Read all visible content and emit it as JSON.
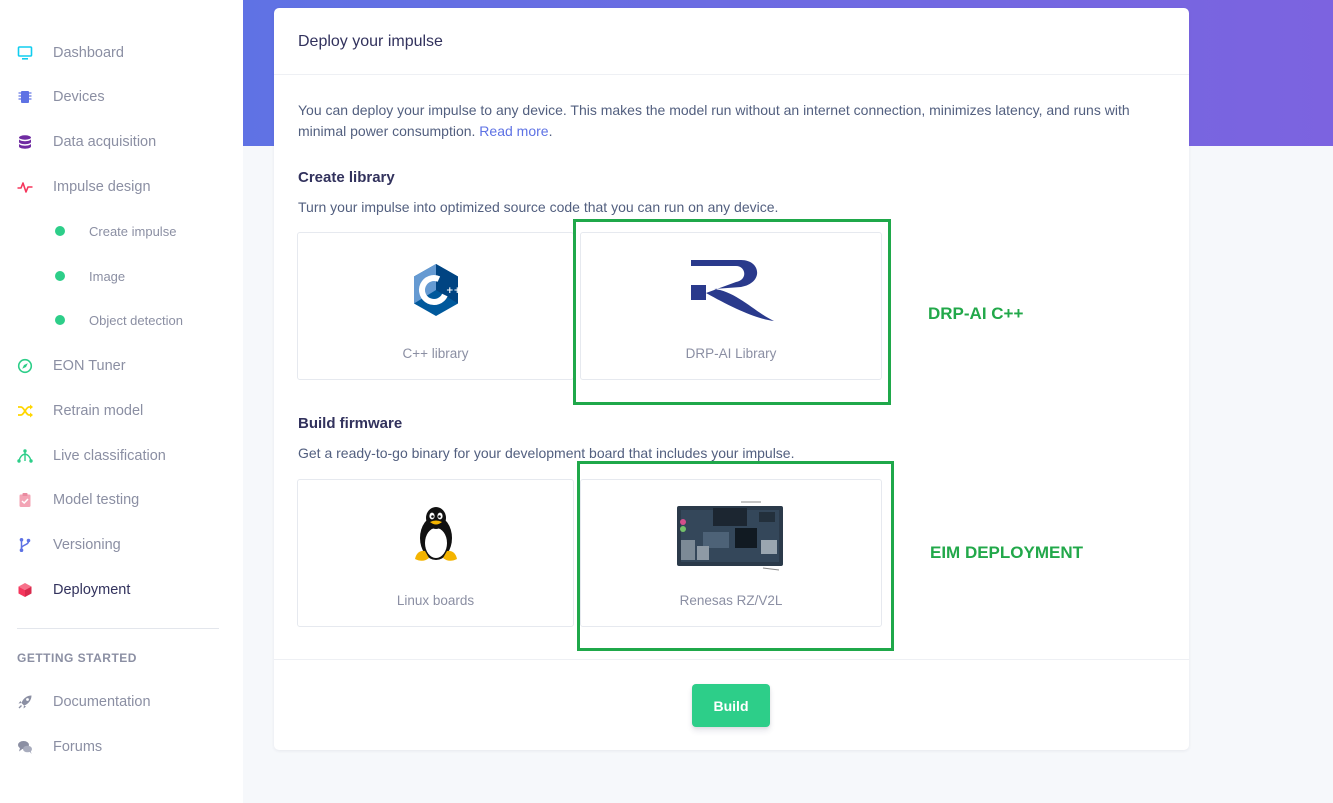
{
  "sidebar": {
    "items": [
      {
        "label": "Dashboard",
        "icon": "monitor-icon",
        "color": "#11cdef"
      },
      {
        "label": "Devices",
        "icon": "chip-icon",
        "color": "#5e72e4"
      },
      {
        "label": "Data acquisition",
        "icon": "database-icon",
        "color": "#6f2ba1"
      },
      {
        "label": "Impulse design",
        "icon": "pulse-icon",
        "color": "#f5365c"
      },
      {
        "label": "EON Tuner",
        "icon": "compass-icon",
        "color": "#2dce89"
      },
      {
        "label": "Retrain model",
        "icon": "shuffle-icon",
        "color": "#ffd600"
      },
      {
        "label": "Live classification",
        "icon": "network-icon",
        "color": "#2dce89"
      },
      {
        "label": "Model testing",
        "icon": "clipboard-check-icon",
        "color": "#f3a4b5"
      },
      {
        "label": "Versioning",
        "icon": "branch-icon",
        "color": "#5e72e4"
      },
      {
        "label": "Deployment",
        "icon": "cube-icon",
        "color": "#f5365c"
      }
    ],
    "sub_items": [
      "Create impulse",
      "Image",
      "Object detection"
    ],
    "getting_started_heading": "GETTING STARTED",
    "getting_started": [
      {
        "label": "Documentation",
        "icon": "rocket-icon"
      },
      {
        "label": "Forums",
        "icon": "chat-icon"
      }
    ]
  },
  "card": {
    "title": "Deploy your impulse",
    "intro": "You can deploy your impulse to any device. This makes the model run without an internet connection, minimizes latency, and runs with minimal power consumption.",
    "read_more": "Read more",
    "period": ".",
    "create_library": {
      "title": "Create library",
      "desc": "Turn your impulse into optimized source code that you can run on any device.",
      "options": [
        "C++ library",
        "DRP-AI Library"
      ]
    },
    "build_firmware": {
      "title": "Build firmware",
      "desc": "Get a ready-to-go binary for your development board that includes your impulse.",
      "options": [
        "Linux boards",
        "Renesas RZ/V2L"
      ]
    },
    "build_label": "Build"
  },
  "annotations": {
    "drp_label": "DRP-AI C++",
    "eim_label": "EIM DEPLOYMENT",
    "color": "#1fa84a"
  },
  "colors": {
    "banner_start": "#5f72e4",
    "banner_end": "#7c63e0",
    "build_button": "#2dce89",
    "link": "#5e72e4"
  }
}
